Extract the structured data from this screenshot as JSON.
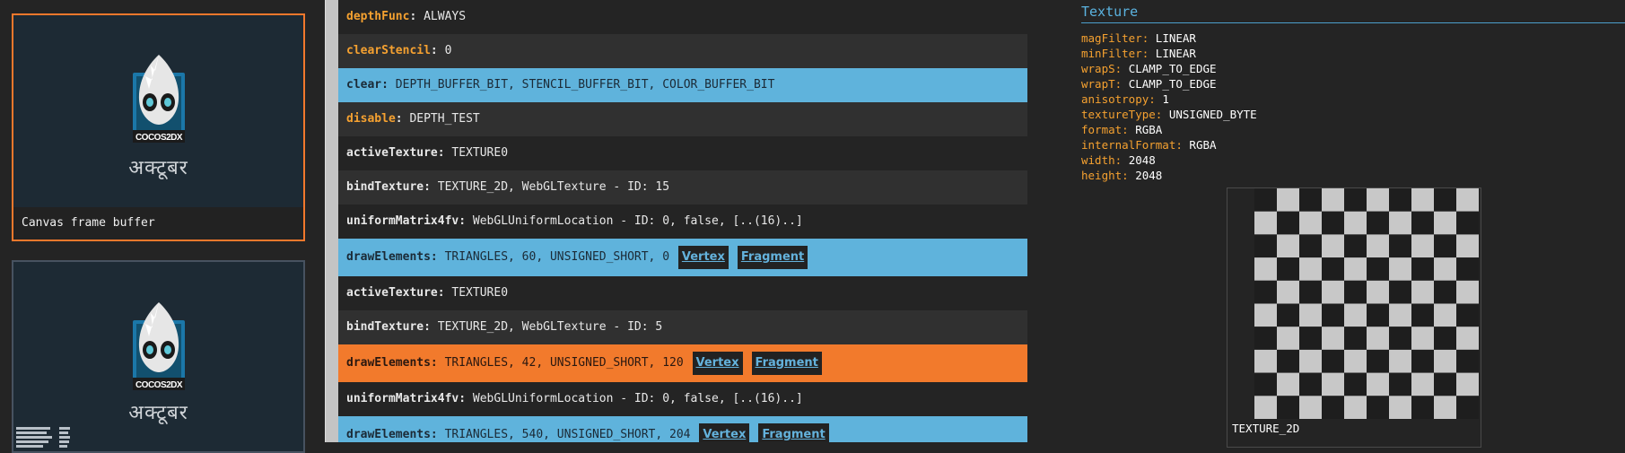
{
  "captures": [
    {
      "caption": "Canvas frame buffer",
      "logo_text": "COCOS2DX",
      "text": "अक्टूबर",
      "selected": true
    },
    {
      "caption": "",
      "logo_text": "COCOS2DX",
      "text": "अक्टूबर",
      "selected": false
    }
  ],
  "commands": [
    {
      "name": "depthFunc",
      "args": "ALWAYS",
      "style": "dark",
      "state": true
    },
    {
      "name": "clearStencil",
      "args": "0",
      "style": "alt",
      "state": true
    },
    {
      "name": "clear",
      "args": "DEPTH_BUFFER_BIT, STENCIL_BUFFER_BIT, COLOR_BUFFER_BIT",
      "style": "blue"
    },
    {
      "name": "disable",
      "args": "DEPTH_TEST",
      "style": "alt",
      "state": true
    },
    {
      "name": "activeTexture",
      "args": "TEXTURE0",
      "style": "dark"
    },
    {
      "name": "bindTexture",
      "args": "TEXTURE_2D, WebGLTexture - ID: 15",
      "style": "alt"
    },
    {
      "name": "uniformMatrix4fv",
      "args": "WebGLUniformLocation - ID: 0, false, [..(16)..]",
      "style": "dark"
    },
    {
      "name": "drawElements",
      "args": "TRIANGLES, 60, UNSIGNED_SHORT, 0",
      "style": "blue",
      "links": [
        "Vertex",
        "Fragment"
      ]
    },
    {
      "name": "activeTexture",
      "args": "TEXTURE0",
      "style": "dark"
    },
    {
      "name": "bindTexture",
      "args": "TEXTURE_2D, WebGLTexture - ID: 5",
      "style": "alt"
    },
    {
      "name": "drawElements",
      "args": "TRIANGLES, 42, UNSIGNED_SHORT, 120",
      "style": "orange",
      "links": [
        "Vertex",
        "Fragment"
      ]
    },
    {
      "name": "uniformMatrix4fv",
      "args": "WebGLUniformLocation - ID: 0, false, [..(16)..]",
      "style": "dark"
    },
    {
      "name": "drawElements",
      "args": "TRIANGLES, 540, UNSIGNED_SHORT, 204",
      "style": "blue",
      "links": [
        "Vertex",
        "Fragment"
      ]
    }
  ],
  "texture": {
    "title": "Texture",
    "properties": [
      {
        "key": "magFilter",
        "value": "LINEAR"
      },
      {
        "key": "minFilter",
        "value": "LINEAR"
      },
      {
        "key": "wrapS",
        "value": "CLAMP_TO_EDGE"
      },
      {
        "key": "wrapT",
        "value": "CLAMP_TO_EDGE"
      },
      {
        "key": "anisotropy",
        "value": "1"
      },
      {
        "key": "textureType",
        "value": "UNSIGNED_BYTE"
      },
      {
        "key": "format",
        "value": "RGBA"
      },
      {
        "key": "internalFormat",
        "value": "RGBA"
      },
      {
        "key": "width",
        "value": "2048"
      },
      {
        "key": "height",
        "value": "2048"
      }
    ],
    "target": "TEXTURE_2D"
  },
  "colors": {
    "accent_orange": "#f27a2c",
    "selection_blue": "#5fb3dc",
    "state_key": "#f5a130",
    "link": "#64b2dc",
    "checker_light": "#c8c8c8",
    "checker_dark": "#1e1e1e"
  }
}
